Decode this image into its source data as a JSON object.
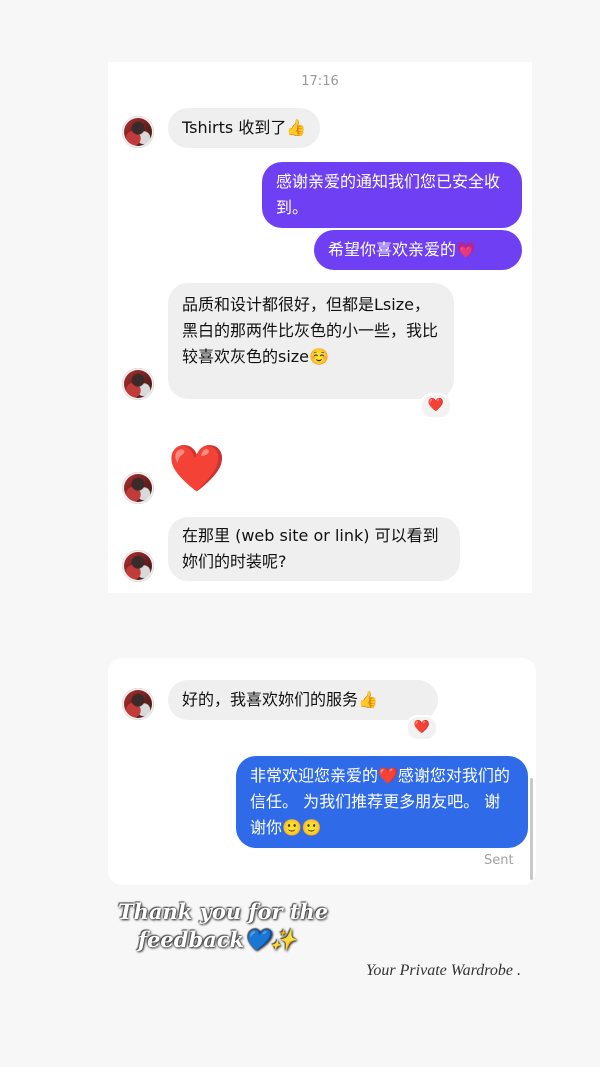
{
  "conversation1": {
    "timestamp": "17:16",
    "messages": [
      {
        "text": "Tshirts 收到了👍"
      },
      {
        "text": "感谢亲爱的通知我们您已安全收到。"
      },
      {
        "text": "希望你喜欢亲爱的💗"
      },
      {
        "text": "品质和设计都很好，但都是Lsize，黑白的那两件比灰色的小一些，我比较喜欢灰色的size☺️",
        "reaction": "❤️"
      },
      {
        "text": "❤️"
      },
      {
        "text": "在那里 (web site or link) 可以看到妳们的时装呢?"
      }
    ]
  },
  "conversation2": {
    "messages": [
      {
        "text": "好的，我喜欢妳们的服务👍",
        "reaction": "❤️"
      },
      {
        "text": "非常欢迎您亲爱的❤️感谢您对我们的信任。 为我们推荐更多朋友吧。 谢谢你🙂🙂"
      }
    ],
    "status": "Sent"
  },
  "overlay": {
    "thanks_line1": "Thank you for the",
    "thanks_line2": "feedback💙✨",
    "signature": "Your Private Wardrobe ."
  },
  "colors": {
    "incoming_bubble": "#efefef",
    "outgoing_purple": "#6f3ff3",
    "outgoing_blue": "#2f6ae8"
  }
}
